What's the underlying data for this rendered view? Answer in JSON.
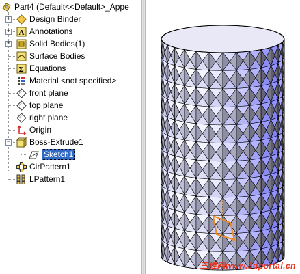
{
  "tree": {
    "root_label": "Part4  (Default<<Default>_Appe",
    "items": [
      {
        "label": "Design Binder",
        "icon": "design-binder-icon"
      },
      {
        "label": "Annotations",
        "icon": "annotations-icon"
      },
      {
        "label": "Solid Bodies(1)",
        "icon": "solid-bodies-icon"
      },
      {
        "label": "Surface Bodies",
        "icon": "surface-bodies-icon"
      },
      {
        "label": "Equations",
        "icon": "equations-icon"
      },
      {
        "label": "Material <not specified>",
        "icon": "material-icon"
      },
      {
        "label": "front plane",
        "icon": "plane-icon"
      },
      {
        "label": "top plane",
        "icon": "plane-icon"
      },
      {
        "label": "right plane",
        "icon": "plane-icon"
      },
      {
        "label": "Origin",
        "icon": "origin-icon"
      },
      {
        "label": "Boss-Extrude1",
        "icon": "boss-extrude-icon"
      },
      {
        "label": "Sketch1",
        "icon": "sketch-icon"
      },
      {
        "label": "CirPattern1",
        "icon": "circular-pattern-icon"
      },
      {
        "label": "LPattern1",
        "icon": "linear-pattern-icon"
      }
    ]
  },
  "viewport": {
    "watermark": "三维网www.3dportal.cn"
  },
  "colors": {
    "selection": "#316ac5",
    "watermark": "#e5341c",
    "model_face": "#e8e8f6",
    "model_edge": "#000000",
    "highlight_face": "#f08a1c"
  }
}
